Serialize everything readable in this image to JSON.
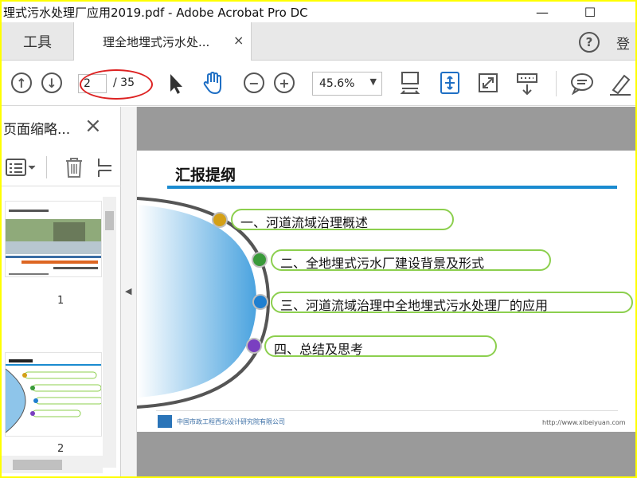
{
  "window": {
    "title": "理式污水处理厂应用2019.pdf - Adobe Acrobat Pro DC",
    "minimize": "—",
    "maximize": "☐"
  },
  "tabs": {
    "tools_label": "工具",
    "doc_tab_label": "理全地埋式污水处...",
    "close_glyph": "×",
    "help_glyph": "?",
    "signin_label": "登"
  },
  "toolbar": {
    "page_current": "2",
    "page_total": "/ 35",
    "zoom_value": "45.6%",
    "zoom_arrow": "▼",
    "prev_glyph": "↑",
    "next_glyph": "↓",
    "zoom_out_glyph": "−",
    "zoom_in_glyph": "+"
  },
  "sidebar": {
    "title": "页面缩略...",
    "close_glyph": "×",
    "thumbnails": [
      {
        "number": "1"
      },
      {
        "number": "2"
      }
    ],
    "collapse_glyph": "◀"
  },
  "slide": {
    "title": "汇报提纲",
    "items": [
      {
        "text": "一、河道流域治理概述",
        "dot_color": "#d4a017"
      },
      {
        "text": "二、全地埋式污水厂建设背景及形式",
        "dot_color": "#3a9a3a"
      },
      {
        "text": "三、河道流域治理中全地埋式污水处理厂的应用",
        "dot_color": "#1f7fd0"
      },
      {
        "text": "四、总结及思考",
        "dot_color": "#7a3fc0"
      }
    ],
    "footer_left": "中国市政工程西北设计研究院有限公司",
    "footer_right": "http://www.xibeiyuan.com"
  },
  "colors": {
    "accent_blue": "#1a8bd0",
    "bubble_border": "#8ccf4e",
    "annotation_red": "#d22222"
  }
}
